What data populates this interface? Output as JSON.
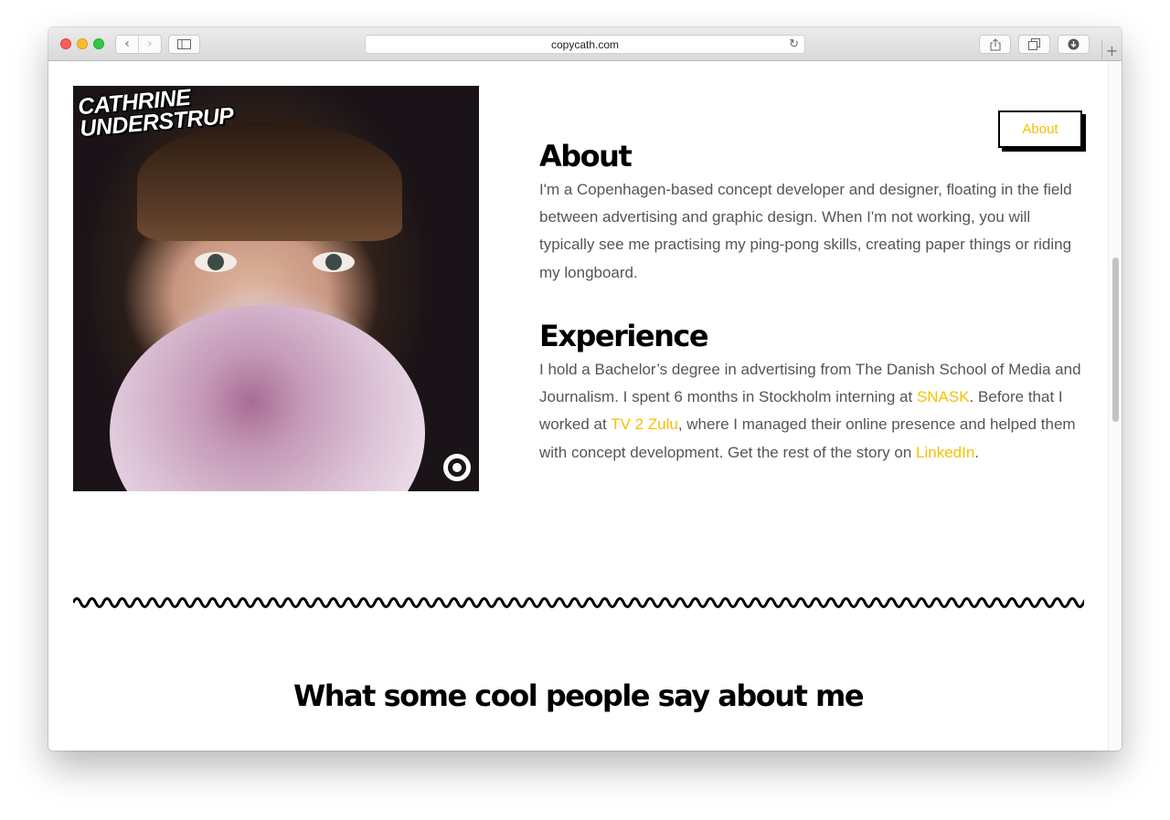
{
  "browser": {
    "url": "copycath.com",
    "back_glyph": "‹",
    "forward_glyph": "›",
    "new_tab_glyph": "+"
  },
  "photo": {
    "logo_line1": "CATHRINE",
    "logo_line2": "UNDERSTRUP"
  },
  "nav": {
    "about_label": "About"
  },
  "about": {
    "heading": "About",
    "text": "I'm a Copenhagen-based concept developer and designer, floating in the field between advertising and graphic design. When I'm not working, you will typically see me practising my ping-pong skills, creating paper things or riding my longboard."
  },
  "experience": {
    "heading": "Experience",
    "text1": "I hold a Bachelor’s degree in advertising from The Danish School of Media and Journalism. I spent 6 months in Stockholm interning at ",
    "link1": "SNASK",
    "text2": ". Before that I worked at ",
    "link2": "TV 2 Zulu",
    "text3": ", where I managed their online presence and helped them with concept development. Get the rest of the story on ",
    "link3": "LinkedIn",
    "text4": "."
  },
  "testimonials": {
    "heading": "What some cool people say about me"
  },
  "colors": {
    "accent": "#f5c000",
    "heading": "#000000",
    "body_text": "#555555"
  }
}
